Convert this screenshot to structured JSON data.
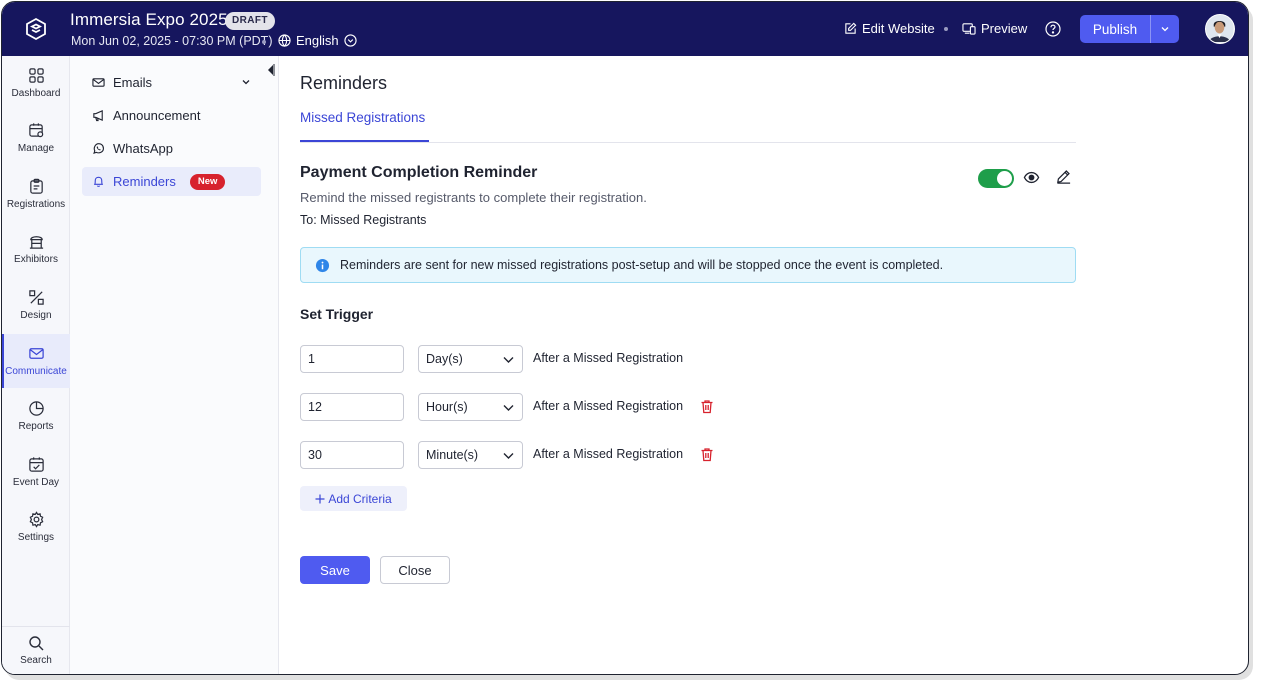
{
  "header": {
    "event_title": "Immersia Expo 2025",
    "status_badge": "DRAFT",
    "event_date": "Mon Jun 02, 2025 - 07:30 PM (PDT)",
    "language": "English",
    "edit_website": "Edit Website",
    "preview": "Preview",
    "publish": "Publish"
  },
  "leftnav": {
    "items": [
      {
        "label": "Dashboard",
        "icon": "grid-icon"
      },
      {
        "label": "Manage",
        "icon": "calendar-gear-icon"
      },
      {
        "label": "Registrations",
        "icon": "clipboard-icon"
      },
      {
        "label": "Exhibitors",
        "icon": "booth-icon"
      },
      {
        "label": "Design",
        "icon": "design-tools-icon"
      },
      {
        "label": "Communicate",
        "icon": "mail-icon"
      },
      {
        "label": "Reports",
        "icon": "pie-chart-icon"
      },
      {
        "label": "Event Day",
        "icon": "calendar-check-icon"
      },
      {
        "label": "Settings",
        "icon": "gear-icon"
      }
    ],
    "active": "Communicate",
    "search": "Search"
  },
  "subnav": {
    "items": [
      {
        "label": "Emails",
        "icon": "mail-icon"
      },
      {
        "label": "Announcement",
        "icon": "megaphone-icon"
      },
      {
        "label": "WhatsApp",
        "icon": "whatsapp-icon"
      },
      {
        "label": "Reminders",
        "icon": "bell-icon",
        "badge": "New"
      }
    ],
    "active": "Reminders"
  },
  "main": {
    "title": "Reminders",
    "tab": "Missed Registrations",
    "card": {
      "title": "Payment Completion Reminder",
      "description": "Remind the missed registrants to complete their registration.",
      "to": "To: Missed Registrants",
      "enabled": true
    },
    "info": "Reminders are sent for new missed registrations post-setup and will be stopped once the event is completed.",
    "trigger_title": "Set Trigger",
    "triggers": [
      {
        "value": "1",
        "unit": "Day(s)",
        "label": "After a Missed Registration",
        "deletable": false
      },
      {
        "value": "12",
        "unit": "Hour(s)",
        "label": "After a Missed Registration",
        "deletable": true
      },
      {
        "value": "30",
        "unit": "Minute(s)",
        "label": "After a Missed Registration",
        "deletable": true
      }
    ],
    "add_criteria": "Add Criteria",
    "save": "Save",
    "close": "Close"
  },
  "colors": {
    "topbar": "#16165e",
    "accent": "#4f5bf0",
    "active_text": "#3b46d6",
    "toggle_on": "#1e9e4a",
    "danger": "#d7222d",
    "info_bg": "#e9f7fd"
  }
}
